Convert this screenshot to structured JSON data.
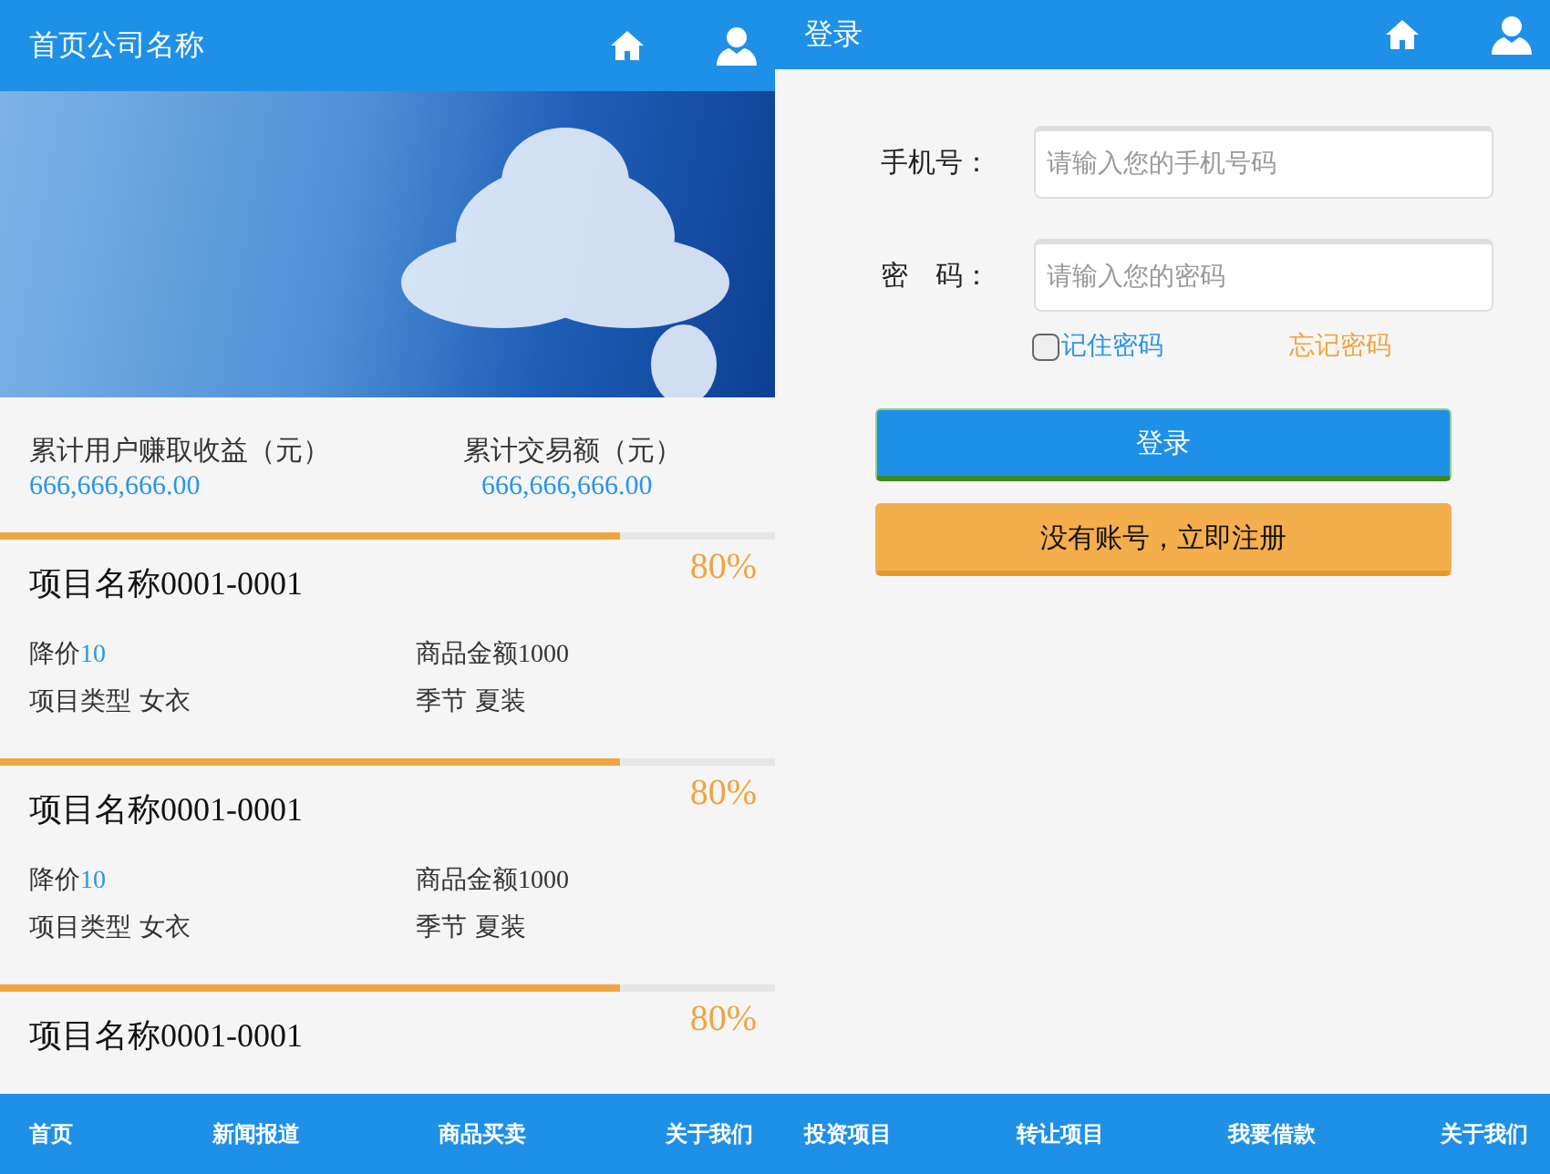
{
  "left_screen": {
    "header": {
      "title": "首页公司名称"
    },
    "stats": [
      {
        "label": "累计用户赚取收益（元）",
        "value": "666,666,666.00"
      },
      {
        "label": "累计交易额（元）",
        "value": "666,666,666.00"
      }
    ],
    "projects": [
      {
        "title": "项目名称0001-0001",
        "level": 0.8,
        "percent": "80%",
        "discount_label": "降价",
        "discount_value": "10",
        "amount": "商品金额1000",
        "type": "项目类型 女衣",
        "season": "季节 夏装"
      },
      {
        "title": "项目名称0001-0001",
        "level": 0.8,
        "percent": "80%",
        "discount_label": "降价",
        "discount_value": "10",
        "amount": "商品金额1000",
        "type": "项目类型 女衣",
        "season": "季节 夏装"
      },
      {
        "title": "项目名称0001-0001",
        "level": 0.8,
        "percent": "80%"
      }
    ],
    "nav": [
      "首页",
      "新闻报道",
      "商品买卖",
      "关于我们"
    ]
  },
  "right_screen": {
    "header": {
      "title": "登录"
    },
    "fields": [
      {
        "label": "手机号：",
        "placeholder": "请输入您的手机号码"
      },
      {
        "label": "密　码：",
        "placeholder": "请输入您的密码"
      }
    ],
    "remember": {
      "label": "记住密码",
      "checked": false
    },
    "forgot_link": "忘记密码",
    "login_button": "登录",
    "register_button": "没有账号，立即注册",
    "nav": [
      "投资项目",
      "转让项目",
      "我要借款",
      "关于我们"
    ]
  }
}
